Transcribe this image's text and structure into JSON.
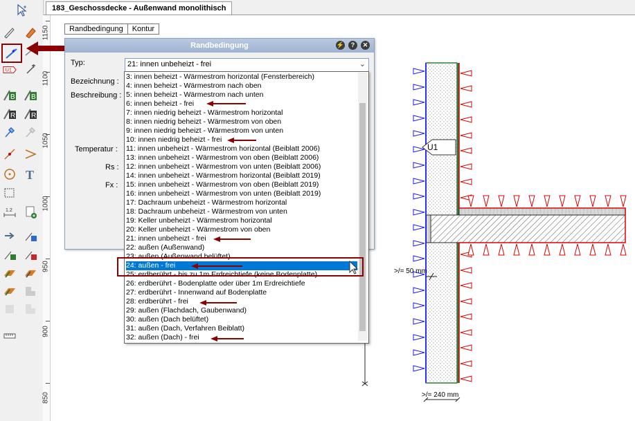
{
  "document_tab": "183_Geschossdecke - Außenwand monolithisch",
  "ruler_labels": [
    "1150",
    "1100",
    "1050",
    "1000",
    "950",
    "900",
    "850"
  ],
  "grid_tabs": [
    "Randbedingung",
    "Kontur"
  ],
  "dialog": {
    "title": "Randbedingung",
    "fields": {
      "typ": "Typ:",
      "bezeichnung": "Bezeichnung :",
      "beschreibung": "Beschreibung :",
      "temperatur": "Temperatur :",
      "rs": "Rs :",
      "fx": "Fx :"
    },
    "selected_type": "21: innen unbeheizt - frei"
  },
  "type_options": [
    "3: innen beheizt - Wärmestrom horizontal (Fensterbereich)",
    "4: innen beheizt - Wärmestrom nach oben",
    "5: innen beheizt - Wärmestrom nach unten",
    "6: innen beheizt - frei",
    "7: innen niedrig beheizt - Wärmestrom horizontal",
    "8: innen niedrig beheizt - Wärmestrom von oben",
    "9: innen niedrig beheizt - Wärmestrom von unten",
    "10: innen niedrig beheizt - frei",
    "11: innen unbeheizt - Wärmestrom horizontal (Beiblatt 2006)",
    "13: innen unbeheizt - Wärmestrom von oben (Beiblatt 2006)",
    "12: innen unbeheizt - Wärmestrom von unten (Beiblatt 2006)",
    "14: innen unbeheizt - Wärmestrom horizontal (Beiblatt 2019)",
    "15: innen unbeheizt - Wärmestrom von oben (Beiblatt 2019)",
    "16: innen unbeheizt - Wärmestrom von unten (Beiblatt 2019)",
    "17: Dachraum unbeheizt - Wärmestrom horizontal",
    "18: Dachraum unbeheizt - Wärmestrom von unten",
    "19: Keller unbeheizt - Wärmestrom horizontal",
    "20: Keller unbeheizt - Wärmestrom von oben",
    "21: innen unbeheizt - frei",
    "22: außen (Außenwand)",
    "23: außen (Außenwand belüftet)",
    "24: außen - frei",
    "25: erdberührt - bis zu 1m Erdreichtiefe (keine Bodenplatte)",
    "26: erdberührt - Bodenplatte oder über 1m Erdreichtiefe",
    "27: erdberührt - Innenwand auf Bodenplatte",
    "28: erdberührt - frei",
    "29: außen (Flachdach, Gaubenwand)",
    "30: außen (Dach belüftet)",
    "31: außen (Dach, Verfahren Beiblatt)",
    "32: außen (Dach) - frei"
  ],
  "highlighted_option": "24: außen - frei",
  "drawing": {
    "boundary_label": "U1",
    "dim_min_50": ">/= 50 mm",
    "dim_min_240": ">/= 240 mm"
  },
  "colors": {
    "accent_red": "#8b0000",
    "selection_blue": "#0078d7",
    "interior_blue": "#1a1aff",
    "exterior_red": "#e00000"
  },
  "icons": [
    "cursor-icon",
    "line-icon",
    "boundary-condition-icon",
    "u1-label-icon",
    "material-b-icon",
    "material-r-icon",
    "eyedropper-icon",
    "text-icon",
    "circle-icon",
    "measure-icon"
  ]
}
